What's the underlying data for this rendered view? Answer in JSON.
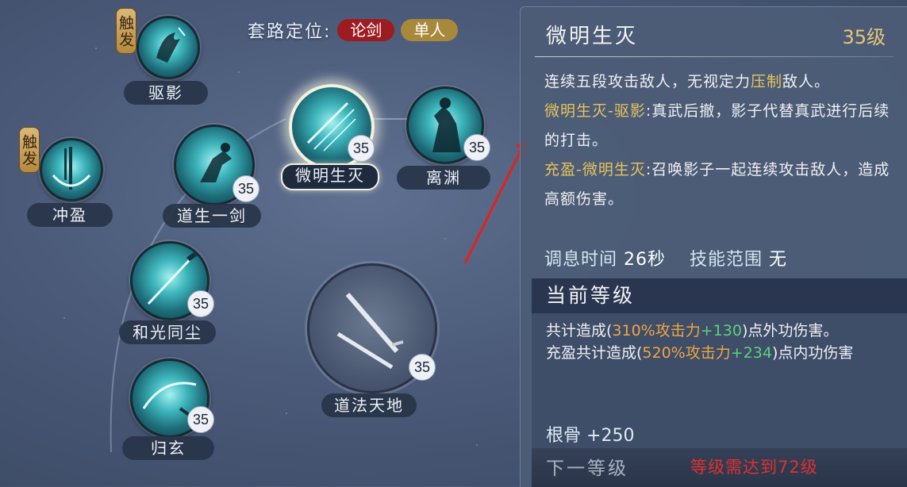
{
  "header": {
    "label": "套路定位:",
    "tags": [
      "论剑",
      "单人"
    ]
  },
  "trigger_label": "触发",
  "skills": {
    "quying": {
      "name": "驱影"
    },
    "chongying": {
      "name": "冲盈"
    },
    "daosheng": {
      "name": "道生一剑",
      "level": "35"
    },
    "weiming": {
      "name": "微明生灭",
      "level": "35"
    },
    "liyuan": {
      "name": "离渊",
      "level": "35"
    },
    "heguang": {
      "name": "和光同尘",
      "level": "35"
    },
    "guixuan": {
      "name": "归玄",
      "level": "35"
    },
    "daofa": {
      "name": "道法天地",
      "level": "35"
    }
  },
  "panel": {
    "title": "微明生灭",
    "level": "35级",
    "desc_1a": "连续五段攻击敌人，无视定力",
    "desc_1b": "压制",
    "desc_1c": "敌人。",
    "desc_2_name": "微明生灭-驱影",
    "desc_2_text": ":真武后撤，影子代替真武进行后续的打击。",
    "desc_3_name": "充盈-微明生灭",
    "desc_3_text": ":召唤影子一起连续攻击敌人，造成高额伤害。",
    "cooldown_label": "调息时间",
    "cooldown_value": "26秒",
    "range_label": "技能范围",
    "range_value": "无",
    "current_level_title": "当前等级",
    "cur_1a": "共计造成(",
    "cur_1b": "310%攻击力",
    "cur_1c": "+130",
    "cur_1d": ")点外功伤害。",
    "cur_2a": "充盈共计造成(",
    "cur_2b": "520%攻击力",
    "cur_2c": "+234",
    "cur_2d": ")点内功伤害",
    "bone_label": "根骨",
    "bone_value": "+250",
    "next_level_title": "下一等级",
    "next_requirement": "等级需达到72级"
  }
}
